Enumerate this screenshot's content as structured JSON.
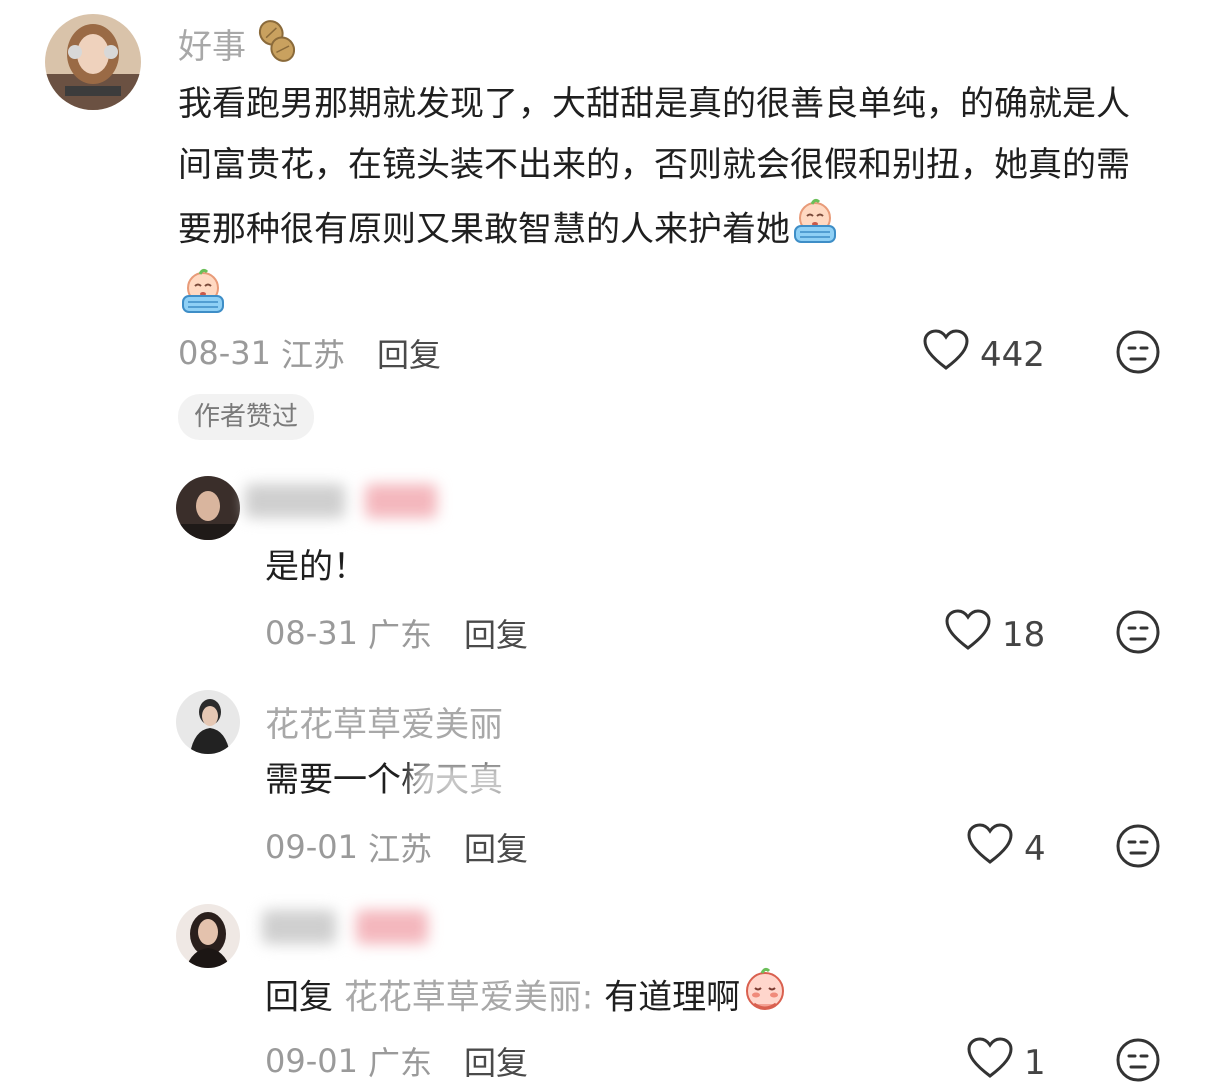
{
  "comments": [
    {
      "author": "好事",
      "text": "我看跑男那期就发现了，大甜甜是真的很善良单纯，的确就是人间富贵花，在镜头装不出来的，否则就会很假和别扭，她真的需要那种很有原则又果敢智慧的人来护着她",
      "date": "08-31",
      "location": "江苏",
      "reply_label": "回复",
      "likes": "442",
      "badge": "作者赞过",
      "author_icon": "peanut-icon",
      "emoji": "crying-face-icon"
    },
    {
      "author": "",
      "text": "是的！",
      "date": "08-31",
      "location": "广东",
      "reply_label": "回复",
      "likes": "18"
    },
    {
      "author": "花花草草爱美丽",
      "text": "需要一个杨天真",
      "date": "09-01",
      "location": "江苏",
      "reply_label": "回复",
      "likes": "4"
    },
    {
      "author": "",
      "reply_prefix": "回复",
      "reply_to": "花花草草爱美丽:",
      "text": "有道理啊",
      "date": "09-01",
      "location": "广东",
      "reply_label": "回复",
      "likes": "1",
      "emoji": "blushing-face-icon"
    }
  ]
}
